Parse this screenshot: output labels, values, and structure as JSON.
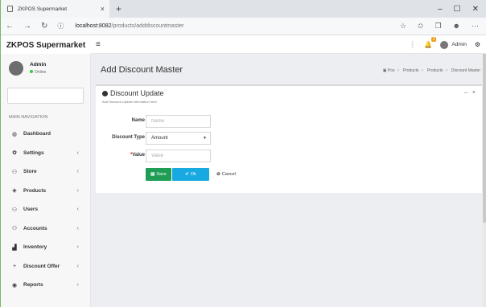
{
  "browser": {
    "tab_title": "ZKPOS Supermarket",
    "tab_close": "×",
    "new_tab": "+",
    "url_host": "localhost:8082",
    "url_path": "/products/adddiscountmaster",
    "window_minimize": "–",
    "window_maximize": "☐",
    "window_close": "✕"
  },
  "header": {
    "brand": "ZKPOS Supermarket",
    "menu_icon": "≡",
    "notification_count": "3",
    "admin_label": "Admin"
  },
  "sidebar": {
    "user_name": "Admin",
    "user_status": "Online",
    "nav_heading": "MAIN NAVIGATION",
    "items": [
      {
        "label": "Dashboard",
        "icon": "dashboard-icon",
        "glyph": "◍",
        "has_submenu": false
      },
      {
        "label": "Settings",
        "icon": "gear-icon",
        "glyph": "✿",
        "has_submenu": true
      },
      {
        "label": "Store",
        "icon": "users-icon",
        "glyph": "⚇",
        "has_submenu": true
      },
      {
        "label": "Products",
        "icon": "tags-icon",
        "glyph": "◈",
        "has_submenu": true
      },
      {
        "label": "Users",
        "icon": "users-icon",
        "glyph": "⚇",
        "has_submenu": true
      },
      {
        "label": "Accounts",
        "icon": "users-icon",
        "glyph": "⚇",
        "has_submenu": true
      },
      {
        "label": "Inventory",
        "icon": "chart-icon",
        "glyph": "▟",
        "has_submenu": true
      },
      {
        "label": "Discount Offer",
        "icon": "plus-icon",
        "glyph": "+",
        "has_submenu": true
      },
      {
        "label": "Reports",
        "icon": "eye-icon",
        "glyph": "◉",
        "has_submenu": true
      }
    ]
  },
  "content": {
    "page_title": "Add Discount Master",
    "breadcrumb": [
      "Pos",
      "Products",
      "Products",
      "Discount Master"
    ],
    "card": {
      "title": "Discount Update",
      "subtitle": "Add Discount Update information here.",
      "tool_minimize": "–",
      "tool_close": "×",
      "form": {
        "name_label": "Name",
        "name_placeholder": "Name",
        "type_label": "Discount Type",
        "type_value": "Amount",
        "value_required_mark": "*",
        "value_label": "Value",
        "value_placeholder": "Value"
      },
      "buttons": {
        "save": "Save",
        "ok": "Ok",
        "cancel": "Cancel"
      }
    }
  },
  "colors": {
    "save": "#1f9d55",
    "ok": "#18a9e0",
    "online": "#2ecc40",
    "badge": "#f39c12"
  }
}
